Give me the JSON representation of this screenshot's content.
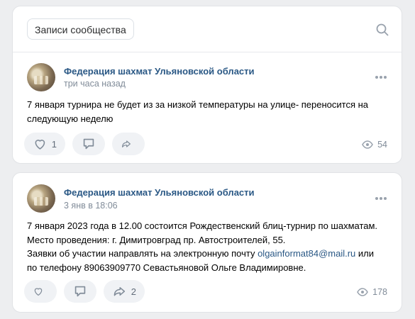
{
  "header": {
    "filter_label": "Записи сообщества"
  },
  "posts": [
    {
      "author": "Федерация шахмат Ульяновской области",
      "time": "три часа назад",
      "text": "7 января турнира не будет из за низкой температуры на улице- переносится на следующую неделю",
      "likes": "1",
      "shares": "",
      "views": "54"
    },
    {
      "author": "Федерация шахмат Ульяновской области",
      "time": "3 янв в 18:06",
      "text_line1": "7 января 2023 года в 12.00 состоится Рождественский блиц-турнир по шахматам.",
      "text_line2": "Место проведения: г. Димитровград пр. Автостроителей, 55.",
      "text_line3_prefix": "Заявки об участии направлять на электронную почту ",
      "text_email": "olgainformat84@mail.ru",
      "text_line3_suffix": " или",
      "text_line4": "по телефону 89063909770 Севастьяновой Ольге Владимировне.",
      "likes": "",
      "shares": "2",
      "views": "178"
    }
  ],
  "colors": {
    "background": "#edeef0",
    "link": "#2a5885",
    "muted": "#818c99",
    "button_bg": "#f0f2f5"
  }
}
